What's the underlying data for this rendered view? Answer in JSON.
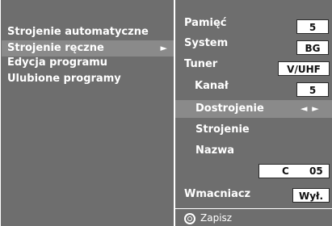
{
  "left_menu": {
    "items": [
      {
        "label": "Strojenie automatyczne",
        "selected": false
      },
      {
        "label": "Strojenie ręczne",
        "selected": true,
        "arrow": "►"
      },
      {
        "label": "Edycja programu",
        "selected": false
      },
      {
        "label": "Ulubione programy",
        "selected": false
      }
    ]
  },
  "settings": {
    "memory": {
      "label": "Pamięć",
      "value": "5"
    },
    "system": {
      "label": "System",
      "value": "BG"
    },
    "tuner": {
      "label": "Tuner",
      "value": "V/UHF"
    },
    "channel": {
      "label": "Kanał",
      "value": "5"
    },
    "fine_tune": {
      "label": "Dostrojenie",
      "value": "◄ ►",
      "selected": true
    },
    "tuning": {
      "label": "Strojenie"
    },
    "name": {
      "label": "Nazwa",
      "value_ch": "C",
      "value_num": "05"
    },
    "booster": {
      "label": "Wmacniacz",
      "value": "Wył."
    }
  },
  "footer": {
    "save_label": "Zapisz",
    "icon": "ok-ring-icon"
  },
  "colors": {
    "panel": "#6e6e6e",
    "highlight": "#8a8a8a",
    "text": "#ffffff",
    "value_box": "#ffffff"
  }
}
